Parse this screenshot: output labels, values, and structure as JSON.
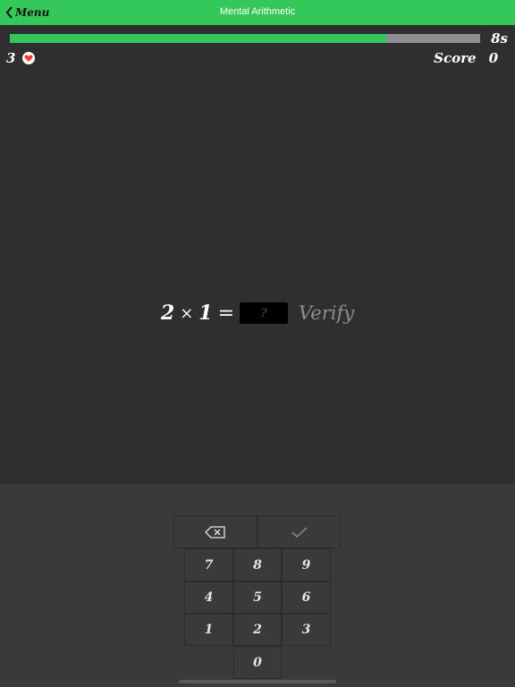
{
  "navbar": {
    "back_label": "Menu",
    "title": "Mental Arithmetic"
  },
  "status": {
    "progress": 0.8,
    "timer": "8s",
    "lives": "3",
    "score_label": "Score",
    "score_value": "0"
  },
  "question": {
    "operand1": "2",
    "operator": "×",
    "operand2": "1",
    "equals": "=",
    "answer_placeholder": "?",
    "verify_label": "Verify"
  },
  "keypad": {
    "backspace_icon": "backspace-icon",
    "confirm_icon": "checkmark-icon",
    "keys": [
      "7",
      "8",
      "9",
      "4",
      "5",
      "6",
      "1",
      "2",
      "3",
      "0"
    ]
  },
  "colors": {
    "accent": "#34c759",
    "heart": "#ff3b30",
    "background": "#2f2f2f",
    "track": "#8e8e93"
  }
}
